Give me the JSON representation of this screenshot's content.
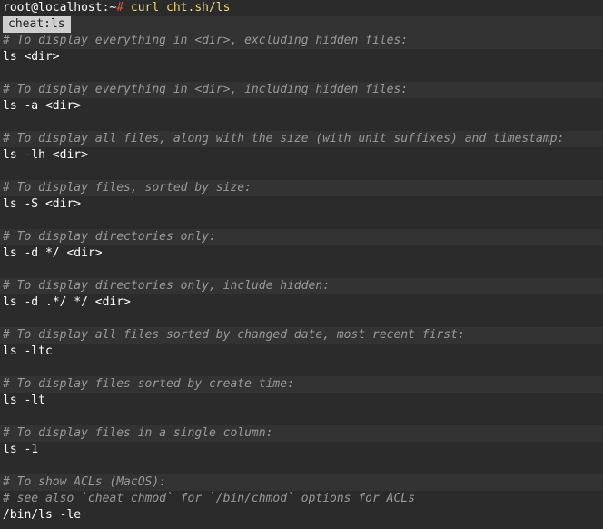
{
  "prompt": {
    "user_host": "root@localhost:~",
    "hash": "#",
    "command": " curl cht.sh/ls"
  },
  "tag": "cheat:ls",
  "entries": [
    {
      "comment": "# To display everything in <dir>, excluding hidden files:",
      "command": "ls <dir>"
    },
    {
      "comment": "# To display everything in <dir>, including hidden files:",
      "command": "ls -a <dir>"
    },
    {
      "comment": "# To display all files, along with the size (with unit suffixes) and timestamp:",
      "command": "ls -lh <dir>"
    },
    {
      "comment": "# To display files, sorted by size:",
      "command": "ls -S <dir>"
    },
    {
      "comment": "# To display directories only:",
      "command": "ls -d */ <dir>"
    },
    {
      "comment": "# To display directories only, include hidden:",
      "command": "ls -d .*/ */ <dir>"
    },
    {
      "comment": "# To display all files sorted by changed date, most recent first:",
      "command": "ls -ltc"
    },
    {
      "comment": "# To display files sorted by create time:",
      "command": "ls -lt"
    },
    {
      "comment": "# To display files in a single column:",
      "command": "ls -1"
    }
  ],
  "last_entry": {
    "comment1": "# To show ACLs (MacOS):",
    "comment2": "# see also `cheat chmod` for `/bin/chmod` options for ACLs",
    "command": "/bin/ls -le"
  },
  "colors": {
    "background": "#2b2b2b",
    "band": "#333333",
    "comment": "#9a9a9a",
    "prompt_hash": "#e5534b",
    "prompt_command": "#f2d675",
    "tag_bg": "#cfcfcf"
  }
}
